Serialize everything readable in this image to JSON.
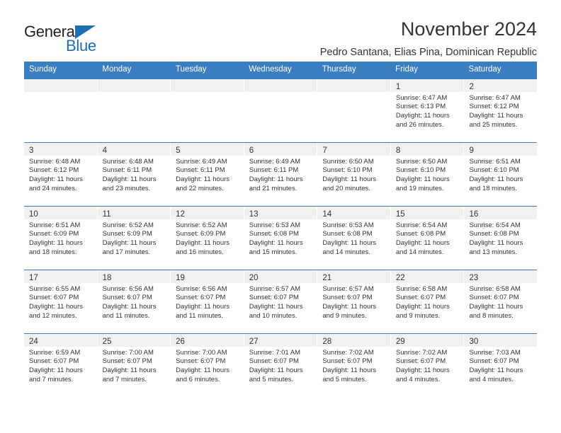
{
  "brand": {
    "word_one": "General",
    "word_two": "Blue",
    "triangle_color": "#1f6eb5",
    "text_color": "#231f20"
  },
  "header": {
    "title": "November 2024",
    "subtitle": "Pedro Santana, Elias Pina, Dominican Republic"
  },
  "theme": {
    "header_blue": "#3a7dc0",
    "day_band_gray": "#f1f1f1",
    "text": "#333333"
  },
  "calendar": {
    "weekday_headers": [
      "Sunday",
      "Monday",
      "Tuesday",
      "Wednesday",
      "Thursday",
      "Friday",
      "Saturday"
    ],
    "weeks": [
      [
        {
          "day": "",
          "lines": []
        },
        {
          "day": "",
          "lines": []
        },
        {
          "day": "",
          "lines": []
        },
        {
          "day": "",
          "lines": []
        },
        {
          "day": "",
          "lines": []
        },
        {
          "day": "1",
          "lines": [
            "Sunrise: 6:47 AM",
            "Sunset: 6:13 PM",
            "Daylight: 11 hours",
            "and 26 minutes."
          ]
        },
        {
          "day": "2",
          "lines": [
            "Sunrise: 6:47 AM",
            "Sunset: 6:12 PM",
            "Daylight: 11 hours",
            "and 25 minutes."
          ]
        }
      ],
      [
        {
          "day": "3",
          "lines": [
            "Sunrise: 6:48 AM",
            "Sunset: 6:12 PM",
            "Daylight: 11 hours",
            "and 24 minutes."
          ]
        },
        {
          "day": "4",
          "lines": [
            "Sunrise: 6:48 AM",
            "Sunset: 6:11 PM",
            "Daylight: 11 hours",
            "and 23 minutes."
          ]
        },
        {
          "day": "5",
          "lines": [
            "Sunrise: 6:49 AM",
            "Sunset: 6:11 PM",
            "Daylight: 11 hours",
            "and 22 minutes."
          ]
        },
        {
          "day": "6",
          "lines": [
            "Sunrise: 6:49 AM",
            "Sunset: 6:11 PM",
            "Daylight: 11 hours",
            "and 21 minutes."
          ]
        },
        {
          "day": "7",
          "lines": [
            "Sunrise: 6:50 AM",
            "Sunset: 6:10 PM",
            "Daylight: 11 hours",
            "and 20 minutes."
          ]
        },
        {
          "day": "8",
          "lines": [
            "Sunrise: 6:50 AM",
            "Sunset: 6:10 PM",
            "Daylight: 11 hours",
            "and 19 minutes."
          ]
        },
        {
          "day": "9",
          "lines": [
            "Sunrise: 6:51 AM",
            "Sunset: 6:10 PM",
            "Daylight: 11 hours",
            "and 18 minutes."
          ]
        }
      ],
      [
        {
          "day": "10",
          "lines": [
            "Sunrise: 6:51 AM",
            "Sunset: 6:09 PM",
            "Daylight: 11 hours",
            "and 18 minutes."
          ]
        },
        {
          "day": "11",
          "lines": [
            "Sunrise: 6:52 AM",
            "Sunset: 6:09 PM",
            "Daylight: 11 hours",
            "and 17 minutes."
          ]
        },
        {
          "day": "12",
          "lines": [
            "Sunrise: 6:52 AM",
            "Sunset: 6:09 PM",
            "Daylight: 11 hours",
            "and 16 minutes."
          ]
        },
        {
          "day": "13",
          "lines": [
            "Sunrise: 6:53 AM",
            "Sunset: 6:08 PM",
            "Daylight: 11 hours",
            "and 15 minutes."
          ]
        },
        {
          "day": "14",
          "lines": [
            "Sunrise: 6:53 AM",
            "Sunset: 6:08 PM",
            "Daylight: 11 hours",
            "and 14 minutes."
          ]
        },
        {
          "day": "15",
          "lines": [
            "Sunrise: 6:54 AM",
            "Sunset: 6:08 PM",
            "Daylight: 11 hours",
            "and 14 minutes."
          ]
        },
        {
          "day": "16",
          "lines": [
            "Sunrise: 6:54 AM",
            "Sunset: 6:08 PM",
            "Daylight: 11 hours",
            "and 13 minutes."
          ]
        }
      ],
      [
        {
          "day": "17",
          "lines": [
            "Sunrise: 6:55 AM",
            "Sunset: 6:07 PM",
            "Daylight: 11 hours",
            "and 12 minutes."
          ]
        },
        {
          "day": "18",
          "lines": [
            "Sunrise: 6:56 AM",
            "Sunset: 6:07 PM",
            "Daylight: 11 hours",
            "and 11 minutes."
          ]
        },
        {
          "day": "19",
          "lines": [
            "Sunrise: 6:56 AM",
            "Sunset: 6:07 PM",
            "Daylight: 11 hours",
            "and 11 minutes."
          ]
        },
        {
          "day": "20",
          "lines": [
            "Sunrise: 6:57 AM",
            "Sunset: 6:07 PM",
            "Daylight: 11 hours",
            "and 10 minutes."
          ]
        },
        {
          "day": "21",
          "lines": [
            "Sunrise: 6:57 AM",
            "Sunset: 6:07 PM",
            "Daylight: 11 hours",
            "and 9 minutes."
          ]
        },
        {
          "day": "22",
          "lines": [
            "Sunrise: 6:58 AM",
            "Sunset: 6:07 PM",
            "Daylight: 11 hours",
            "and 9 minutes."
          ]
        },
        {
          "day": "23",
          "lines": [
            "Sunrise: 6:58 AM",
            "Sunset: 6:07 PM",
            "Daylight: 11 hours",
            "and 8 minutes."
          ]
        }
      ],
      [
        {
          "day": "24",
          "lines": [
            "Sunrise: 6:59 AM",
            "Sunset: 6:07 PM",
            "Daylight: 11 hours",
            "and 7 minutes."
          ]
        },
        {
          "day": "25",
          "lines": [
            "Sunrise: 7:00 AM",
            "Sunset: 6:07 PM",
            "Daylight: 11 hours",
            "and 7 minutes."
          ]
        },
        {
          "day": "26",
          "lines": [
            "Sunrise: 7:00 AM",
            "Sunset: 6:07 PM",
            "Daylight: 11 hours",
            "and 6 minutes."
          ]
        },
        {
          "day": "27",
          "lines": [
            "Sunrise: 7:01 AM",
            "Sunset: 6:07 PM",
            "Daylight: 11 hours",
            "and 5 minutes."
          ]
        },
        {
          "day": "28",
          "lines": [
            "Sunrise: 7:02 AM",
            "Sunset: 6:07 PM",
            "Daylight: 11 hours",
            "and 5 minutes."
          ]
        },
        {
          "day": "29",
          "lines": [
            "Sunrise: 7:02 AM",
            "Sunset: 6:07 PM",
            "Daylight: 11 hours",
            "and 4 minutes."
          ]
        },
        {
          "day": "30",
          "lines": [
            "Sunrise: 7:03 AM",
            "Sunset: 6:07 PM",
            "Daylight: 11 hours",
            "and 4 minutes."
          ]
        }
      ]
    ]
  }
}
